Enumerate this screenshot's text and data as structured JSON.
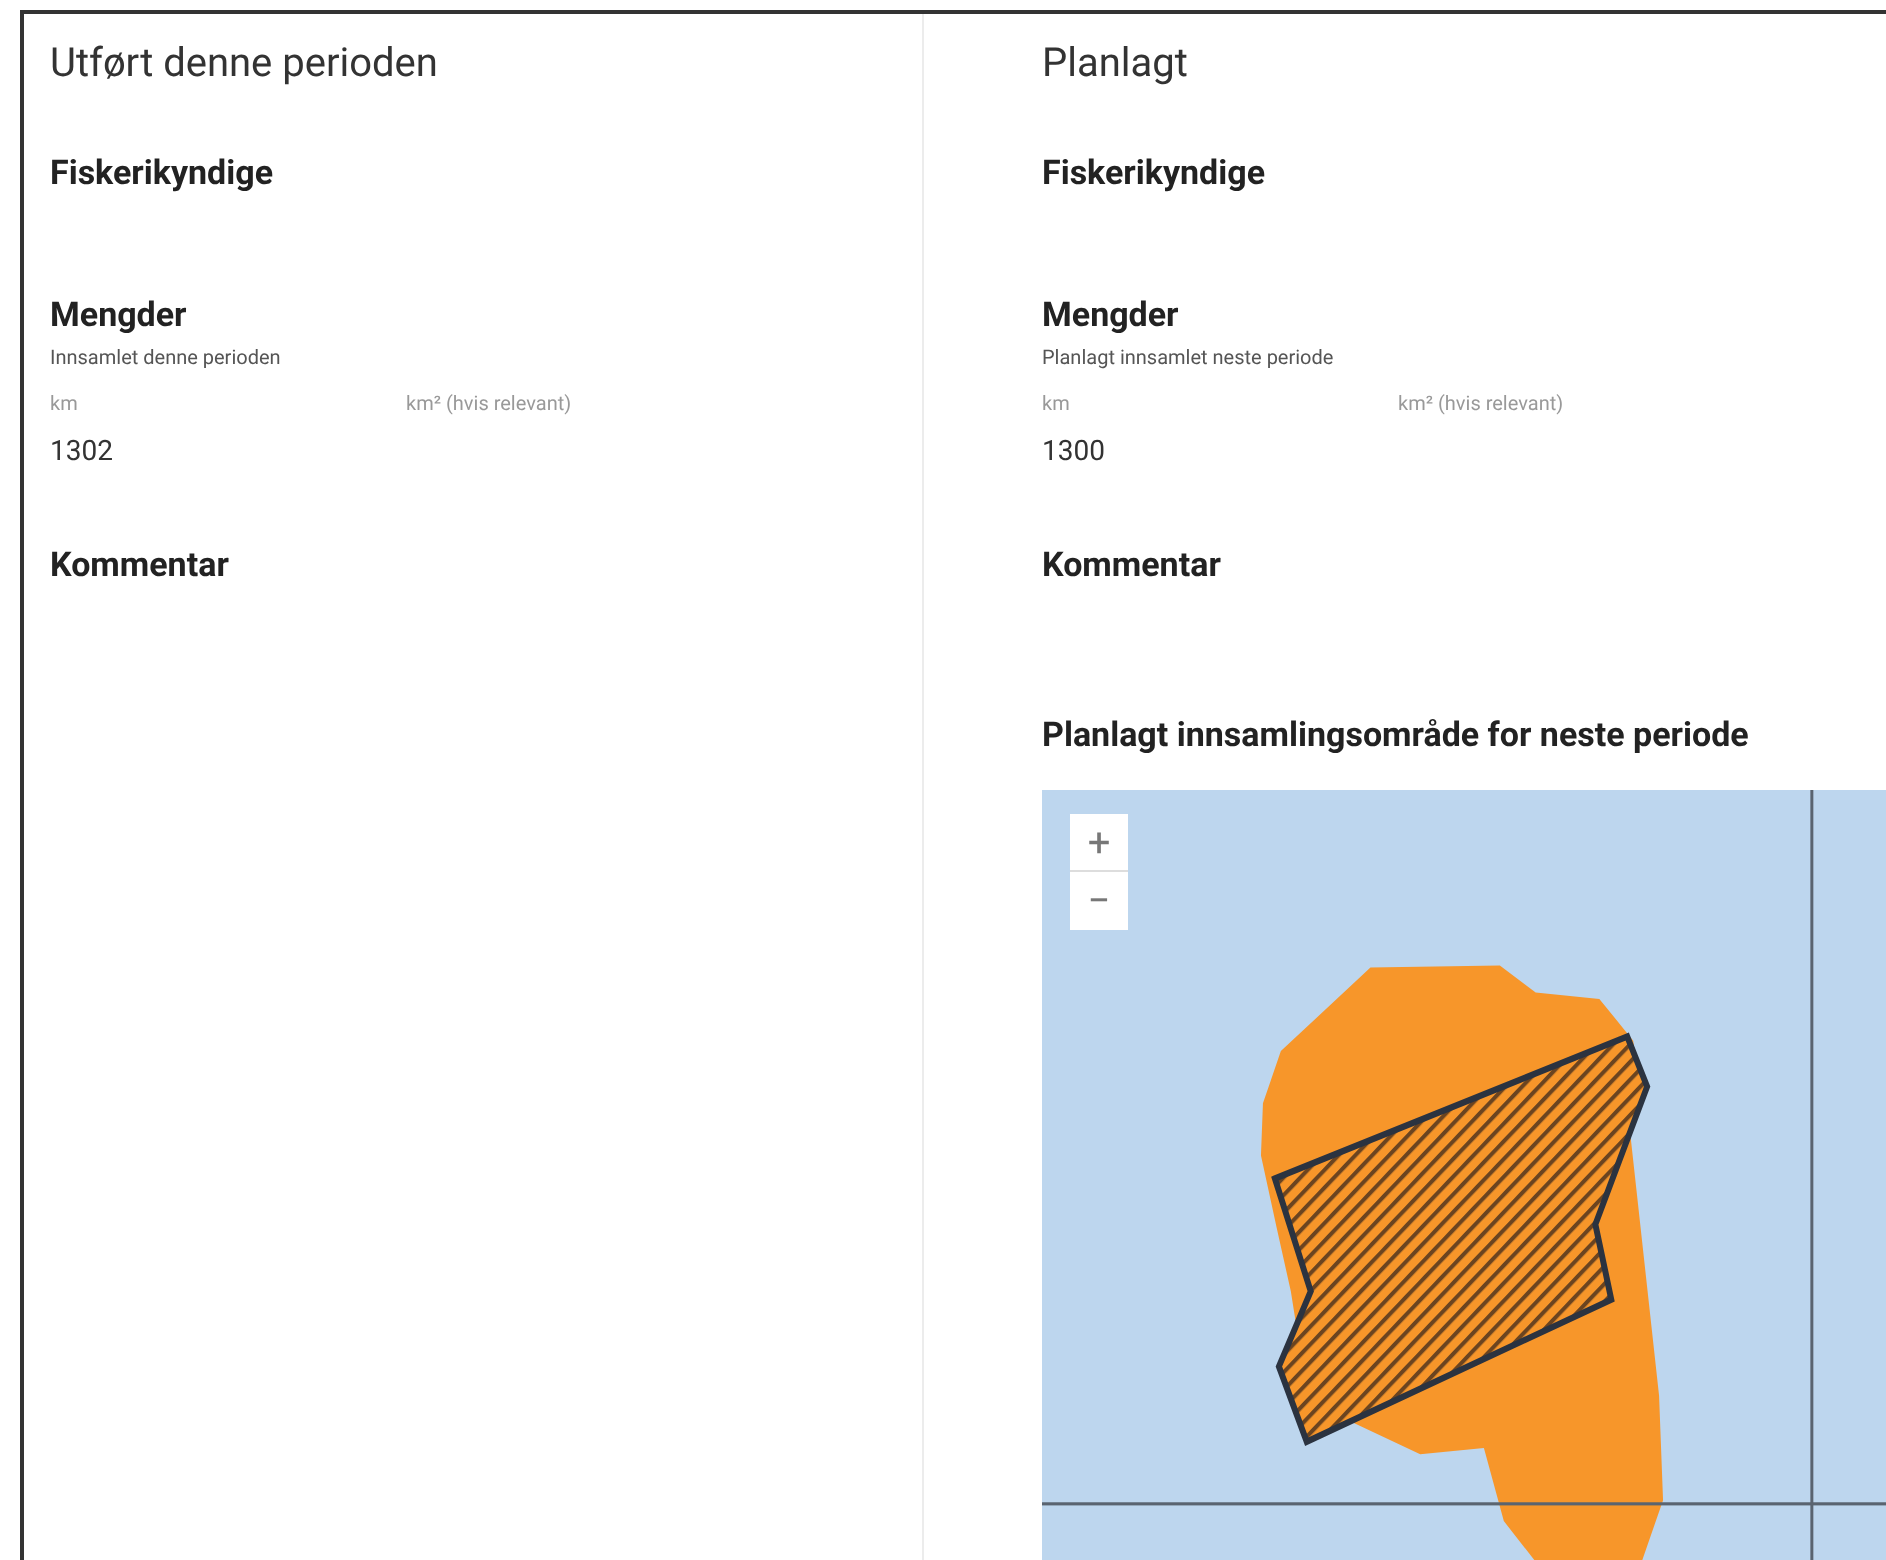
{
  "panels": [
    {
      "title": "Utført denne perioden",
      "fiskerikyndige": {
        "heading": "Fiskerikyndige"
      },
      "mengder": {
        "heading": "Mengder",
        "subtitle": "Innsamlet denne perioden",
        "fields": [
          {
            "label": "km",
            "value": "1302"
          },
          {
            "label": "km² (hvis relevant)"
          }
        ]
      },
      "kommentar": {
        "heading": "Kommentar"
      }
    },
    {
      "title": "Planlagt",
      "fiskerikyndige": {
        "heading": "Fiskerikyndige"
      },
      "mengder": {
        "heading": "Mengder",
        "subtitle": "Planlagt innsamlet neste periode",
        "fields": [
          {
            "label": "km",
            "value": "1300"
          },
          {
            "label": "km² (hvis relevant)"
          }
        ]
      },
      "kommentar": {
        "heading": "Kommentar"
      },
      "map": {
        "heading": "Planlagt innsamlingsområde for neste periode",
        "zoom_in": "+",
        "zoom_out": "−"
      }
    }
  ]
}
